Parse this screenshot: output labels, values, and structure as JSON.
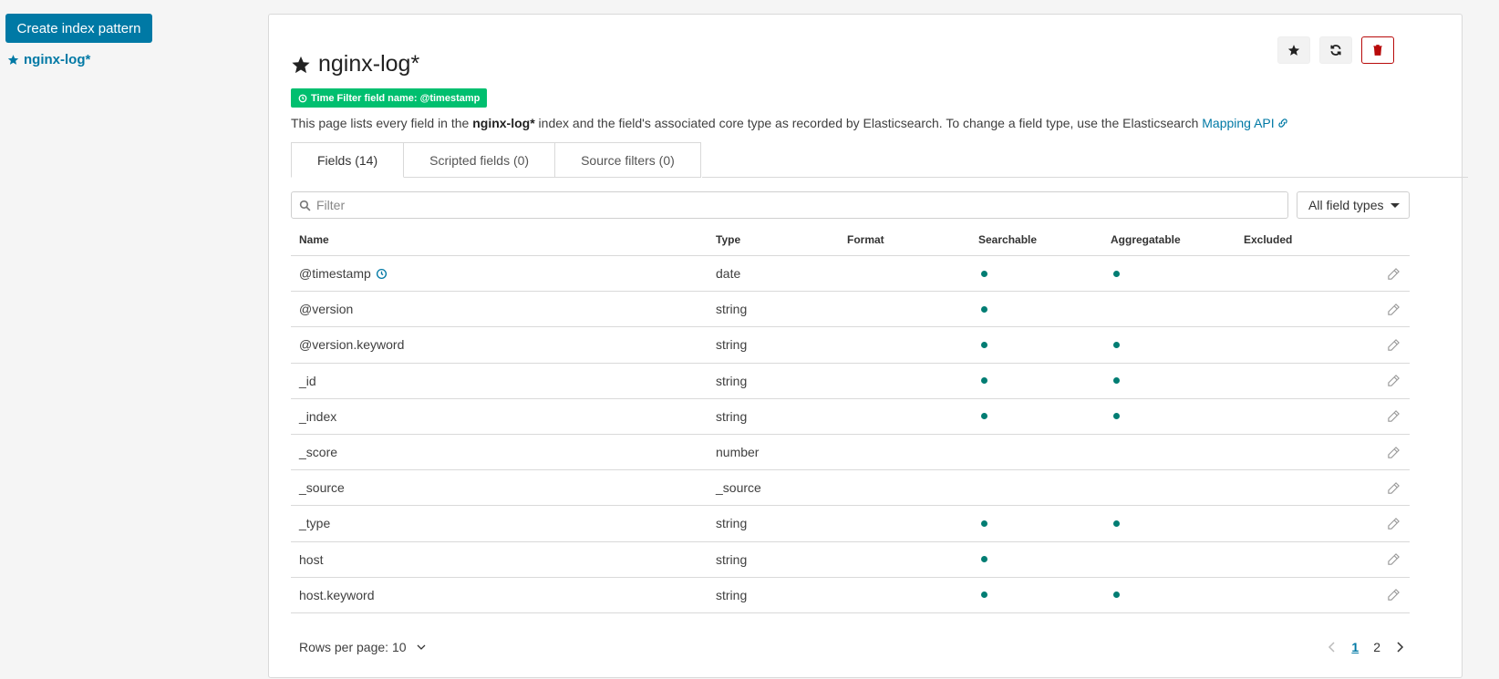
{
  "sidebar": {
    "create_button": "Create index pattern",
    "patterns": [
      {
        "label": "nginx-log*",
        "default": true
      }
    ]
  },
  "header": {
    "title": "nginx-log*",
    "time_filter_badge": "Time Filter field name: @timestamp",
    "description_prefix": "This page lists every field in the ",
    "description_index": "nginx-log*",
    "description_suffix": " index and the field's associated core type as recorded by Elasticsearch. To change a field type, use the Elasticsearch ",
    "mapping_link": "Mapping API",
    "actions": [
      "star-icon",
      "refresh-icon",
      "trash-icon"
    ]
  },
  "tabs": [
    {
      "label": "Fields (14)",
      "active": true
    },
    {
      "label": "Scripted fields (0)",
      "active": false
    },
    {
      "label": "Source filters (0)",
      "active": false
    }
  ],
  "filter": {
    "placeholder": "Filter",
    "value": ""
  },
  "field_type_select": {
    "value": "All field types"
  },
  "table": {
    "columns": [
      "Name",
      "Type",
      "Format",
      "Searchable",
      "Aggregatable",
      "Excluded"
    ],
    "rows": [
      {
        "name": "@timestamp",
        "type": "date",
        "searchable": true,
        "aggregatable": true,
        "time_field": true
      },
      {
        "name": "@version",
        "type": "string",
        "searchable": true,
        "aggregatable": false
      },
      {
        "name": "@version.keyword",
        "type": "string",
        "searchable": true,
        "aggregatable": true
      },
      {
        "name": "_id",
        "type": "string",
        "searchable": true,
        "aggregatable": true
      },
      {
        "name": "_index",
        "type": "string",
        "searchable": true,
        "aggregatable": true
      },
      {
        "name": "_score",
        "type": "number",
        "searchable": false,
        "aggregatable": false
      },
      {
        "name": "_source",
        "type": "_source",
        "searchable": false,
        "aggregatable": false
      },
      {
        "name": "_type",
        "type": "string",
        "searchable": true,
        "aggregatable": true
      },
      {
        "name": "host",
        "type": "string",
        "searchable": true,
        "aggregatable": false
      },
      {
        "name": "host.keyword",
        "type": "string",
        "searchable": true,
        "aggregatable": true
      }
    ]
  },
  "pagination": {
    "rows_per_page": "Rows per page: 10",
    "pages": [
      "1",
      "2"
    ],
    "current_page": "1"
  },
  "colors": {
    "primary": "#0079a5",
    "success_badge": "#00bf6f",
    "dot": "#017d73",
    "danger": "#b80a0a"
  }
}
